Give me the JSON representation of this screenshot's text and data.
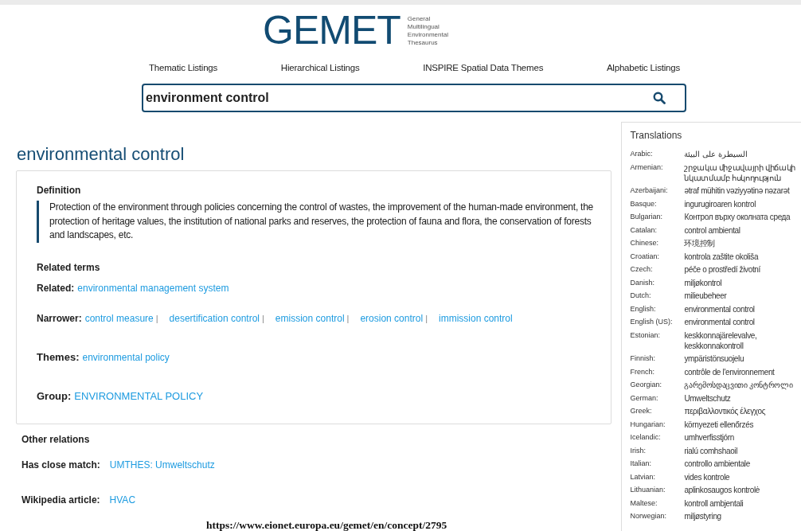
{
  "header": {
    "logo": "GEMET",
    "tagline": [
      "General",
      "Multilingual",
      "Environmental",
      "Thesaurus"
    ]
  },
  "nav": [
    "Thematic Listings",
    "Hierarchical Listings",
    "INSPIRE Spatial Data Themes",
    "Alphabetic Listings"
  ],
  "search": {
    "value": "environment control"
  },
  "concept": {
    "title": "environmental control",
    "definition_heading": "Definition",
    "definition": "Protection of the environment through policies concerning the control of wastes, the improvement of the human-made environment, the protection of heritage values, the institution of national parks and reserves, the protection of fauna and flora, the conservation of forests and landscapes, etc.",
    "related_heading": "Related terms",
    "separator": "|",
    "relations": [
      {
        "label": "Related:",
        "links": [
          "environmental management system"
        ]
      },
      {
        "label": "Narrower:",
        "links": [
          "control measure",
          "desertification control",
          "emission control",
          "erosion control",
          "immission control"
        ]
      },
      {
        "label": "Themes:",
        "links": [
          "environmental policy"
        ]
      },
      {
        "label": "Group:",
        "links": [
          "ENVIRONMENTAL POLICY"
        ]
      }
    ]
  },
  "other_relations": {
    "heading": "Other relations",
    "items": [
      {
        "label": "Has close match:",
        "links": [
          "UMTHES: Umweltschutz"
        ]
      },
      {
        "label": "Wikipedia article:",
        "links": [
          "HVAC"
        ]
      }
    ]
  },
  "translations": {
    "heading": "Translations",
    "rows": [
      {
        "language": "Arabic:",
        "term": "السيطرة على البيئة"
      },
      {
        "language": "Armenian:",
        "term": "շրջակա միջավայրի վիճակի նկատմամբ հսկողություն"
      },
      {
        "language": "Azerbaijani:",
        "term": "ətraf mühitin vəziyyətinə nəzarət"
      },
      {
        "language": "Basque:",
        "term": "ingurugiroaren kontrol"
      },
      {
        "language": "Bulgarian:",
        "term": "Контрол върху околната среда"
      },
      {
        "language": "Catalan:",
        "term": "control ambiental"
      },
      {
        "language": "Chinese:",
        "term": "环境控制"
      },
      {
        "language": "Croatian:",
        "term": "kontrola zaštite okoliša"
      },
      {
        "language": "Czech:",
        "term": "péče o prostředí životní"
      },
      {
        "language": "Danish:",
        "term": "miljøkontrol"
      },
      {
        "language": "Dutch:",
        "term": "milieubeheer"
      },
      {
        "language": "English:",
        "term": "environmental control"
      },
      {
        "language": "English (US):",
        "term": "environmental control"
      },
      {
        "language": "Estonian:",
        "term": "keskkonnajärelevalve, keskkonnakontroll"
      },
      {
        "language": "Finnish:",
        "term": "ympäristönsuojelu"
      },
      {
        "language": "French:",
        "term": "contrôle de l'environnement"
      },
      {
        "language": "Georgian:",
        "term": "გარემოსდაცვითი კონტროლი"
      },
      {
        "language": "German:",
        "term": "Umweltschutz"
      },
      {
        "language": "Greek:",
        "term": "περιβαλλοντικός έλεγχος"
      },
      {
        "language": "Hungarian:",
        "term": "környezeti ellenőrzés"
      },
      {
        "language": "Icelandic:",
        "term": "umhverfisstjórn"
      },
      {
        "language": "Irish:",
        "term": "rialú comhshaoil"
      },
      {
        "language": "Italian:",
        "term": "controllo ambientale"
      },
      {
        "language": "Latvian:",
        "term": "vides kontrole"
      },
      {
        "language": "Lithuanian:",
        "term": "aplinkosaugos kontrolė"
      },
      {
        "language": "Maltese:",
        "term": "kontroll ambjentali"
      },
      {
        "language": "Norwegian:",
        "term": "miljøstyring"
      }
    ]
  },
  "source_url": "https://www.eionet.europa.eu/gemet/en/concept/2795"
}
